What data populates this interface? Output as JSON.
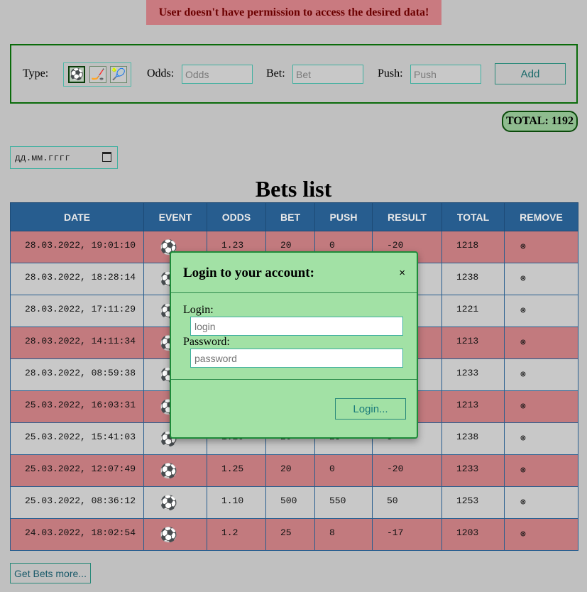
{
  "alert": {
    "text": "User doesn't have permission to access the desired data!"
  },
  "form": {
    "type_label": "Type:",
    "type_options": [
      {
        "icon": "soccer-ball-icon",
        "glyph": "⚽",
        "selected": true
      },
      {
        "icon": "hockey-stick-icon",
        "glyph": "🏒",
        "selected": false
      },
      {
        "icon": "tennis-racket-icon",
        "glyph": "🎾",
        "selected": false
      }
    ],
    "odds_label": "Odds:",
    "odds_placeholder": "Odds",
    "bet_label": "Bet:",
    "bet_placeholder": "Bet",
    "push_label": "Push:",
    "push_placeholder": "Push",
    "add_label": "Add"
  },
  "total": {
    "text": "TOTAL: 1192"
  },
  "date_filter": {
    "placeholder": "дд.мм.гггг"
  },
  "bets": {
    "title": "Bets list",
    "columns": [
      "DATE",
      "EVENT",
      "ODDS",
      "BET",
      "PUSH",
      "RESULT",
      "TOTAL",
      "REMOVE"
    ],
    "rows": [
      {
        "date": "28.03.2022, 19:01:10",
        "odds": "1.23",
        "bet": "20",
        "push": "0",
        "result": "-20",
        "total": "1218",
        "status": "loss"
      },
      {
        "date": "28.03.2022, 18:28:14",
        "odds": "",
        "bet": "",
        "push": "",
        "result": "",
        "total": "1238",
        "status": "win"
      },
      {
        "date": "28.03.2022, 17:11:29",
        "odds": "",
        "bet": "",
        "push": "",
        "result": "",
        "total": "1221",
        "status": "win"
      },
      {
        "date": "28.03.2022, 14:11:34",
        "odds": "",
        "bet": "",
        "push": "",
        "result": "",
        "total": "1213",
        "status": "loss"
      },
      {
        "date": "28.03.2022, 08:59:38",
        "odds": "",
        "bet": "",
        "push": "",
        "result": "",
        "total": "1233",
        "status": "win"
      },
      {
        "date": "25.03.2022, 16:03:31",
        "odds": "",
        "bet": "",
        "push": "",
        "result": "",
        "total": "1213",
        "status": "loss"
      },
      {
        "date": "25.03.2022, 15:41:03",
        "odds": "1.20",
        "bet": "20",
        "push": "25",
        "result": "5",
        "total": "1238",
        "status": "win"
      },
      {
        "date": "25.03.2022, 12:07:49",
        "odds": "1.25",
        "bet": "20",
        "push": "0",
        "result": "-20",
        "total": "1233",
        "status": "loss"
      },
      {
        "date": "25.03.2022, 08:36:12",
        "odds": "1.10",
        "bet": "500",
        "push": "550",
        "result": "50",
        "total": "1253",
        "status": "win"
      },
      {
        "date": "24.03.2022, 18:02:54",
        "odds": "1.2",
        "bet": "25",
        "push": "8",
        "result": "-17",
        "total": "1203",
        "status": "loss"
      }
    ],
    "event_glyph": "⚽",
    "remove_glyph": "⊗",
    "colors": {
      "loss": "#c27a7e",
      "win": "#c8c8c8",
      "header": "#275d8f"
    }
  },
  "more_button": {
    "label": "Get Bets more..."
  },
  "login_modal": {
    "title": "Login to your account:",
    "close": "×",
    "login_label": "Login:",
    "login_placeholder": "login",
    "password_label": "Password:",
    "password_placeholder": "password",
    "submit_label": "Login..."
  }
}
